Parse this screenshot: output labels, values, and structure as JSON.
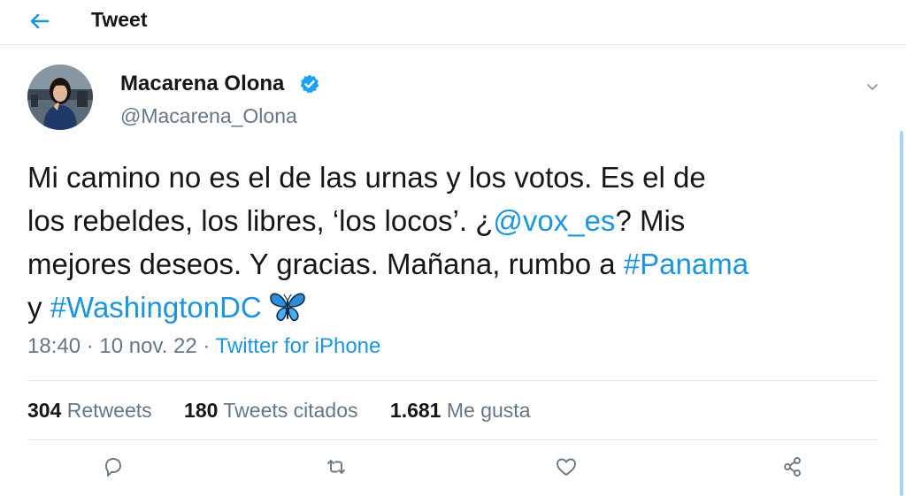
{
  "header": {
    "title": "Tweet",
    "back_icon": "arrow-left-icon"
  },
  "tweet": {
    "author": {
      "name": "Macarena Olona",
      "handle": "@Macarena_Olona",
      "verified": true
    },
    "text": {
      "line1": "Mi camino no es el de las urnas y los votos. Es el de",
      "line2_pre": "los rebeldes, los libres, ‘los locos’. ¿",
      "mention": "@vox_es",
      "line2_post": "? Mis",
      "line3_pre": "mejores deseos. Y gracias. Mañana, rumbo a ",
      "hashtag1": "#Panama",
      "line4_pre": "y ",
      "hashtag2": "#WashingtonDC",
      "emoji": "butterfly-emoji"
    },
    "time": "18:40",
    "separator": "·",
    "date": "10 nov. 22",
    "source": "Twitter for iPhone",
    "stats": {
      "retweets_count": "304",
      "retweets_label": "Retweets",
      "quotes_count": "180",
      "quotes_label": "Tweets citados",
      "likes_count": "1.681",
      "likes_label": "Me gusta"
    }
  },
  "colors": {
    "accent": "#1b95e0",
    "secondary_text": "#657786",
    "primary_text": "#14171a",
    "divider": "#e6ecf0"
  },
  "actions": [
    "reply-icon",
    "retweet-icon",
    "like-icon",
    "share-icon"
  ]
}
